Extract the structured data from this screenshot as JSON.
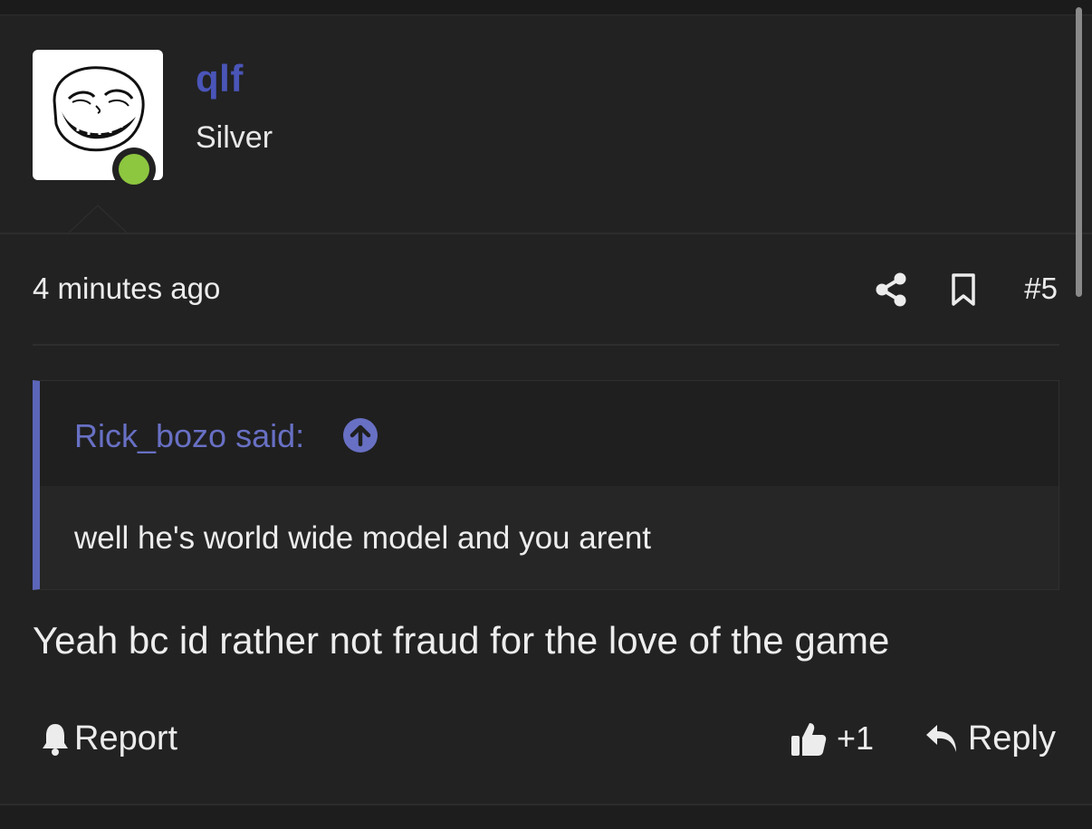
{
  "user": {
    "name": "qlf",
    "title": "Silver",
    "online": true,
    "avatar_icon": "trollface-avatar",
    "name_color": "#4a55b8",
    "online_color": "#8dc63f"
  },
  "post": {
    "timestamp": "4 minutes ago",
    "number": "#5",
    "share_icon": "share-icon",
    "bookmark_icon": "bookmark-icon",
    "body": "Yeah bc id rather not fraud for the love of the game"
  },
  "quote": {
    "author_label": "Rick_bozo said:",
    "text": "well he's world wide model and you arent",
    "accent_color": "#5c66b8"
  },
  "actions": {
    "report_label": "Report",
    "like_count": "+1",
    "reply_label": "Reply"
  }
}
